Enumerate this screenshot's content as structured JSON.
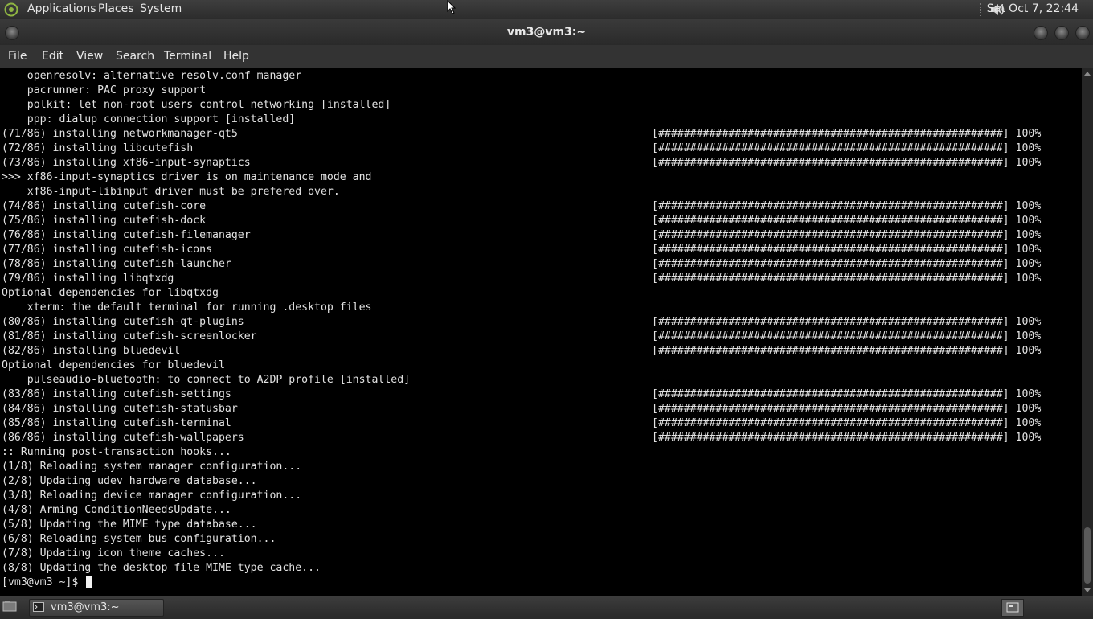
{
  "top_panel": {
    "menus": [
      "Applications",
      "Places",
      "System"
    ],
    "clock": "Sat Oct  7, 22:44",
    "icons": {
      "logo": "distro-logo-icon",
      "volume": "speaker-volume-icon"
    }
  },
  "window": {
    "title": "vm3@vm3:~",
    "menubar": [
      "File",
      "Edit",
      "View",
      "Search",
      "Terminal",
      "Help"
    ]
  },
  "terminal": {
    "lines": [
      {
        "text": "    openresolv: alternative resolv.conf manager",
        "progress": ""
      },
      {
        "text": "    pacrunner: PAC proxy support",
        "progress": ""
      },
      {
        "text": "    polkit: let non-root users control networking [installed]",
        "progress": ""
      },
      {
        "text": "    ppp: dialup connection support [installed]",
        "progress": ""
      },
      {
        "text": "(71/86) installing networkmanager-qt5",
        "progress": "[######################################################] 100%"
      },
      {
        "text": "(72/86) installing libcutefish",
        "progress": "[######################################################] 100%"
      },
      {
        "text": "(73/86) installing xf86-input-synaptics",
        "progress": "[######################################################] 100%"
      },
      {
        "text": ">>> xf86-input-synaptics driver is on maintenance mode and",
        "progress": ""
      },
      {
        "text": "    xf86-input-libinput driver must be prefered over.",
        "progress": ""
      },
      {
        "text": "(74/86) installing cutefish-core",
        "progress": "[######################################################] 100%"
      },
      {
        "text": "(75/86) installing cutefish-dock",
        "progress": "[######################################################] 100%"
      },
      {
        "text": "(76/86) installing cutefish-filemanager",
        "progress": "[######################################################] 100%"
      },
      {
        "text": "(77/86) installing cutefish-icons",
        "progress": "[######################################################] 100%"
      },
      {
        "text": "(78/86) installing cutefish-launcher",
        "progress": "[######################################################] 100%"
      },
      {
        "text": "(79/86) installing libqtxdg",
        "progress": "[######################################################] 100%"
      },
      {
        "text": "Optional dependencies for libqtxdg",
        "progress": ""
      },
      {
        "text": "    xterm: the default terminal for running .desktop files",
        "progress": ""
      },
      {
        "text": "(80/86) installing cutefish-qt-plugins",
        "progress": "[######################################################] 100%"
      },
      {
        "text": "(81/86) installing cutefish-screenlocker",
        "progress": "[######################################################] 100%"
      },
      {
        "text": "(82/86) installing bluedevil",
        "progress": "[######################################################] 100%"
      },
      {
        "text": "Optional dependencies for bluedevil",
        "progress": ""
      },
      {
        "text": "    pulseaudio-bluetooth: to connect to A2DP profile [installed]",
        "progress": ""
      },
      {
        "text": "(83/86) installing cutefish-settings",
        "progress": "[######################################################] 100%"
      },
      {
        "text": "(84/86) installing cutefish-statusbar",
        "progress": "[######################################################] 100%"
      },
      {
        "text": "(85/86) installing cutefish-terminal",
        "progress": "[######################################################] 100%"
      },
      {
        "text": "(86/86) installing cutefish-wallpapers",
        "progress": "[######################################################] 100%"
      },
      {
        "text": ":: Running post-transaction hooks...",
        "progress": ""
      },
      {
        "text": "(1/8) Reloading system manager configuration...",
        "progress": ""
      },
      {
        "text": "(2/8) Updating udev hardware database...",
        "progress": ""
      },
      {
        "text": "(3/8) Reloading device manager configuration...",
        "progress": ""
      },
      {
        "text": "(4/8) Arming ConditionNeedsUpdate...",
        "progress": ""
      },
      {
        "text": "(5/8) Updating the MIME type database...",
        "progress": ""
      },
      {
        "text": "(6/8) Reloading system bus configuration...",
        "progress": ""
      },
      {
        "text": "(7/8) Updating icon theme caches...",
        "progress": ""
      },
      {
        "text": "(8/8) Updating the desktop file MIME type cache...",
        "progress": ""
      }
    ],
    "prompt": "[vm3@vm3 ~]$ "
  },
  "taskbar": {
    "task_label": "vm3@vm3:~",
    "icons": {
      "show_desktop": "show-desktop-icon",
      "task": "terminal-icon",
      "workspace": "workspace-switcher-icon"
    }
  }
}
